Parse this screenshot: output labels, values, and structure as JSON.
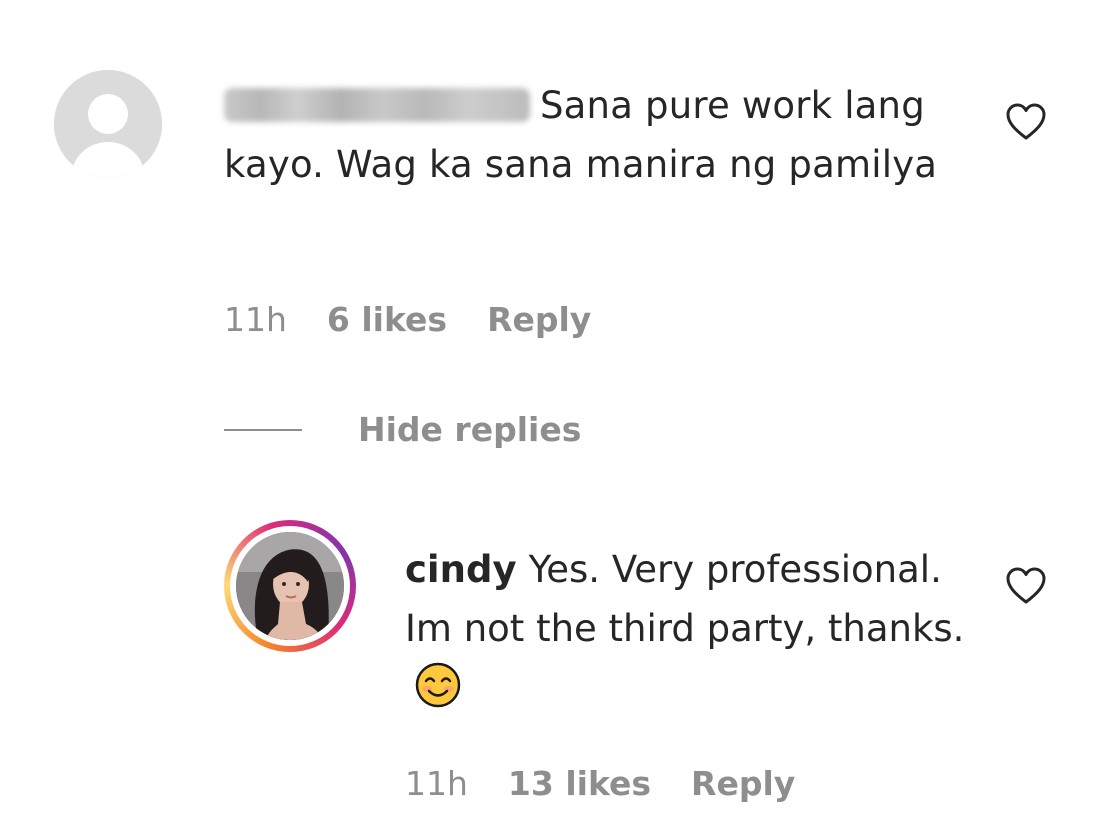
{
  "comment": {
    "username_blurred": true,
    "text": "Sana pure work lang kayo. Wag ka sana manira ng pamilya",
    "timestamp": "11h",
    "likes": "6 likes",
    "reply_label": "Reply",
    "like_icon": "heart-outline-icon"
  },
  "thread": {
    "toggle_label": "Hide replies"
  },
  "reply": {
    "username": "cindy",
    "text": "Yes. Very professional. Im not the third party, thanks.",
    "emoji": "smiling-face-icon",
    "timestamp": "11h",
    "likes": "13 likes",
    "reply_label": "Reply",
    "like_icon": "heart-outline-icon"
  },
  "colors": {
    "text_primary": "#262626",
    "text_secondary": "#8e8e8e",
    "avatar_placeholder": "#dbdbdb",
    "story_ring_start": "#f58529",
    "story_ring_end": "#dd2a7b"
  }
}
